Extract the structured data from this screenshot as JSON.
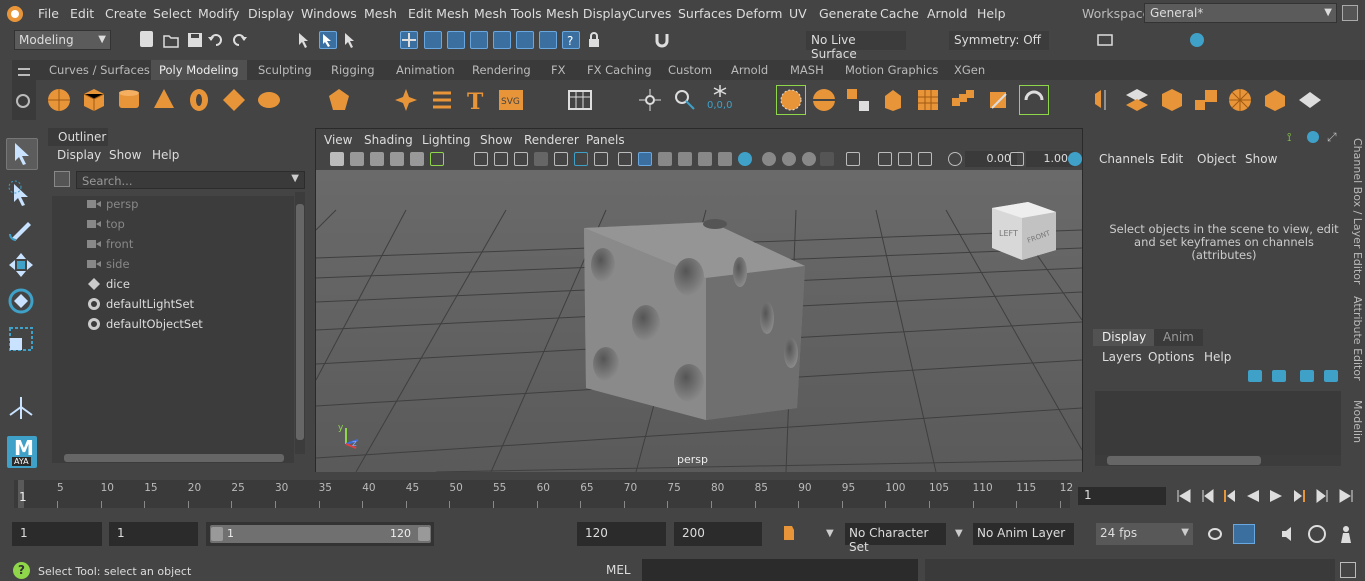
{
  "menubar": {
    "items": [
      "File",
      "Edit",
      "Create",
      "Select",
      "Modify",
      "Display",
      "Windows",
      "Mesh",
      "Edit Mesh",
      "Mesh Tools",
      "Mesh Display",
      "Curves",
      "Surfaces",
      "Deform",
      "UV",
      "Generate",
      "Cache",
      "Arnold",
      "Help"
    ],
    "workspace_label": "Workspace:",
    "workspace_value": "General*"
  },
  "statusline": {
    "mode": "Modeling",
    "live_surface": "No Live Surface",
    "symmetry": "Symmetry: Off"
  },
  "shelf": {
    "tabs": [
      "Curves / Surfaces",
      "Poly Modeling",
      "Sculpting",
      "Rigging",
      "Animation",
      "Rendering",
      "FX",
      "FX Caching",
      "Custom",
      "Arnold",
      "MASH",
      "Motion Graphics",
      "XGen"
    ],
    "active_tab": "Poly Modeling",
    "axis_label": "0,0,0"
  },
  "toolbox": {
    "maya_logo": "M",
    "maya_sub": "AYA"
  },
  "outliner": {
    "title": "Outliner",
    "menu": [
      "Display",
      "Show",
      "Help"
    ],
    "search_placeholder": "Search...",
    "items": [
      {
        "label": "persp",
        "type": "camera",
        "dim": true
      },
      {
        "label": "top",
        "type": "camera",
        "dim": true
      },
      {
        "label": "front",
        "type": "camera",
        "dim": true
      },
      {
        "label": "side",
        "type": "camera",
        "dim": true
      },
      {
        "label": "dice",
        "type": "mesh",
        "dim": false
      },
      {
        "label": "defaultLightSet",
        "type": "set",
        "dim": false
      },
      {
        "label": "defaultObjectSet",
        "type": "set",
        "dim": false
      }
    ]
  },
  "viewport": {
    "menu": [
      "View",
      "Shading",
      "Lighting",
      "Show",
      "Renderer",
      "Panels"
    ],
    "field_a": "0.00",
    "field_b": "1.00",
    "camera_label": "persp",
    "viewcube_left": "LEFT",
    "viewcube_front": "FRONT",
    "axis_y": "y",
    "axis_z": "z"
  },
  "channelbox": {
    "menu": [
      "Channels",
      "Edit",
      "Object",
      "Show"
    ],
    "message": "Select objects in the scene to view, edit and set keyframes on channels (attributes)",
    "layer_tabs": [
      "Display",
      "Anim"
    ],
    "active_layer_tab": "Display",
    "layer_menu": [
      "Layers",
      "Options",
      "Help"
    ],
    "side_tabs": [
      "Channel Box / Layer Editor",
      "Attribute Editor",
      "Modelin"
    ]
  },
  "timeslider": {
    "start_tick": "1",
    "ticks": [
      "5",
      "10",
      "15",
      "20",
      "25",
      "30",
      "35",
      "40",
      "45",
      "50",
      "55",
      "60",
      "65",
      "70",
      "75",
      "80",
      "85",
      "90",
      "95",
      "100",
      "105",
      "110",
      "115",
      "12"
    ],
    "current_frame": "1"
  },
  "rangeslider": {
    "start": "1",
    "playback_start": "1",
    "range_start": "1",
    "range_end": "120",
    "playback_end": "120",
    "end": "200",
    "character_set": "No Character Set",
    "anim_layer": "No Anim Layer",
    "fps": "24 fps"
  },
  "helpline": {
    "text": "Select Tool: select an object",
    "mel_label": "MEL"
  },
  "colors": {
    "accent_blue": "#3a6fa0",
    "shelf_orange": "#e8953a",
    "bg": "#444444"
  }
}
